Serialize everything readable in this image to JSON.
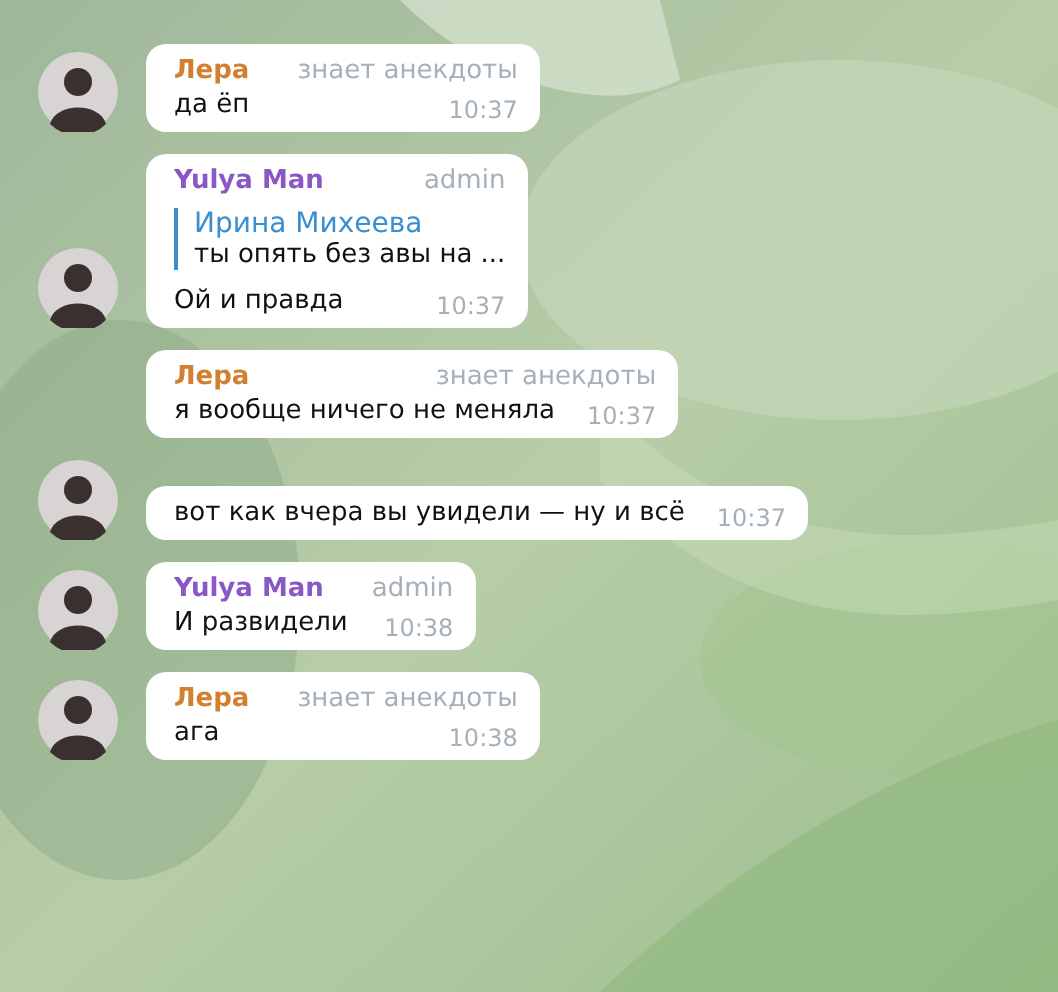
{
  "messages": [
    {
      "sender": "Лера",
      "color": "#d2802f",
      "role": "знает анекдоты",
      "text": "да ёп",
      "time": "10:37",
      "avatar": true
    },
    {
      "sender": "Yulya Man",
      "color": "#8a58c4",
      "role": "admin",
      "reply": {
        "author": "Ирина Михеева",
        "text": "ты опять без авы на ..."
      },
      "text": "Ой и правда",
      "time": "10:37",
      "avatar": true
    },
    {
      "sender": "Лера",
      "color": "#d2802f",
      "role": "знает анекдоты",
      "text": "я вообще ничего не меняла",
      "time": "10:37",
      "avatar": false
    },
    {
      "text": "вот как вчера вы увидели — ну и всё",
      "time": "10:37",
      "avatar": true
    },
    {
      "sender": "Yulya Man",
      "color": "#8a58c4",
      "role": "admin",
      "text": "И развидели",
      "time": "10:38",
      "avatar": true
    },
    {
      "sender": "Лера",
      "color": "#d2802f",
      "role": "знает анекдоты",
      "text": "ага",
      "time": "10:38",
      "avatar": true
    }
  ]
}
